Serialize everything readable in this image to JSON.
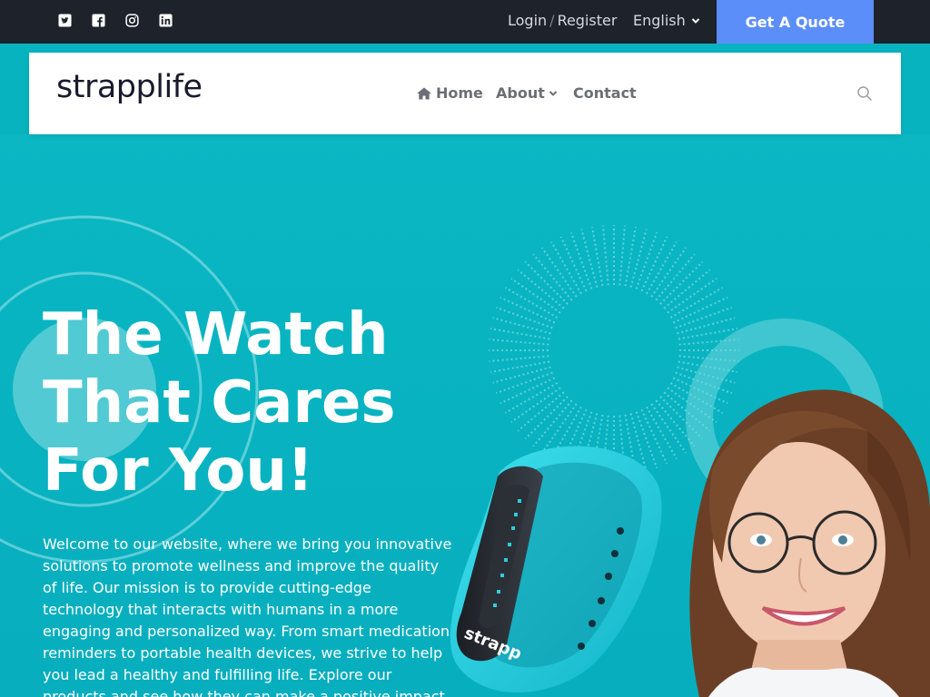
{
  "topbar": {
    "social": [
      {
        "name": "twitter-icon"
      },
      {
        "name": "facebook-icon"
      },
      {
        "name": "instagram-icon"
      },
      {
        "name": "linkedin-icon"
      }
    ],
    "login_label": "Login",
    "separator": "/",
    "register_label": "Register",
    "language_label": "English",
    "quote_button": "Get A Quote"
  },
  "nav": {
    "logo": "strapplife",
    "items": [
      {
        "label": "Home",
        "icon": "home-icon"
      },
      {
        "label": "About",
        "icon": "chevron-down-icon"
      },
      {
        "label": "Contact"
      }
    ],
    "search_icon": "search-icon"
  },
  "hero": {
    "title": "The Watch That Cares For You!",
    "description": "Welcome to our website, where we bring you innovative solutions to promote wellness and improve the quality of life. Our mission is to provide cutting-edge technology that interacts with humans in a more engaging and personalized way. From smart medication reminders to portable health devices, we strive to help you lead a healthy and fulfilling life. Explore our products and see how they can make a positive impact on your well-being.",
    "band_brand": "strapp"
  },
  "colors": {
    "topbar_bg": "#1d222b",
    "accent": "#5c8ef9",
    "hero_bg": "#08b3c0",
    "text_light": "#ffffff"
  }
}
